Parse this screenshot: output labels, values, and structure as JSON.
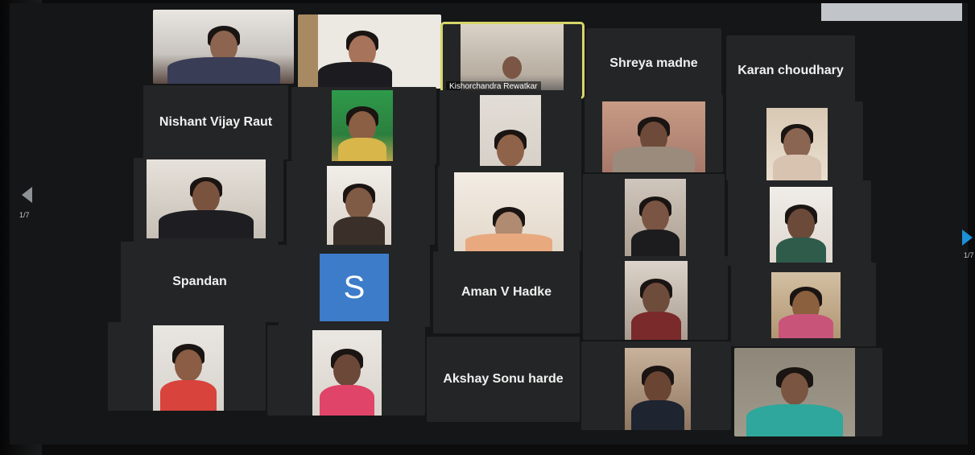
{
  "participants": {
    "shreya": "Shreya madne",
    "karan": "Karan choudhary",
    "nishant": "Nishant Vijay Raut",
    "spandan": "Spandan",
    "aman": "Aman V Hadke",
    "akshay": "Akshay Sonu harde",
    "kishor_caption": "Kishorchandra Rewatkar",
    "avatar_letter": "S"
  },
  "pagination": {
    "left": "1/7",
    "right": "1/7"
  },
  "colors": {
    "avatar": "#3d7cc9",
    "active_border": "#d6d66a",
    "nav_arrow": "#1d8fd6"
  }
}
